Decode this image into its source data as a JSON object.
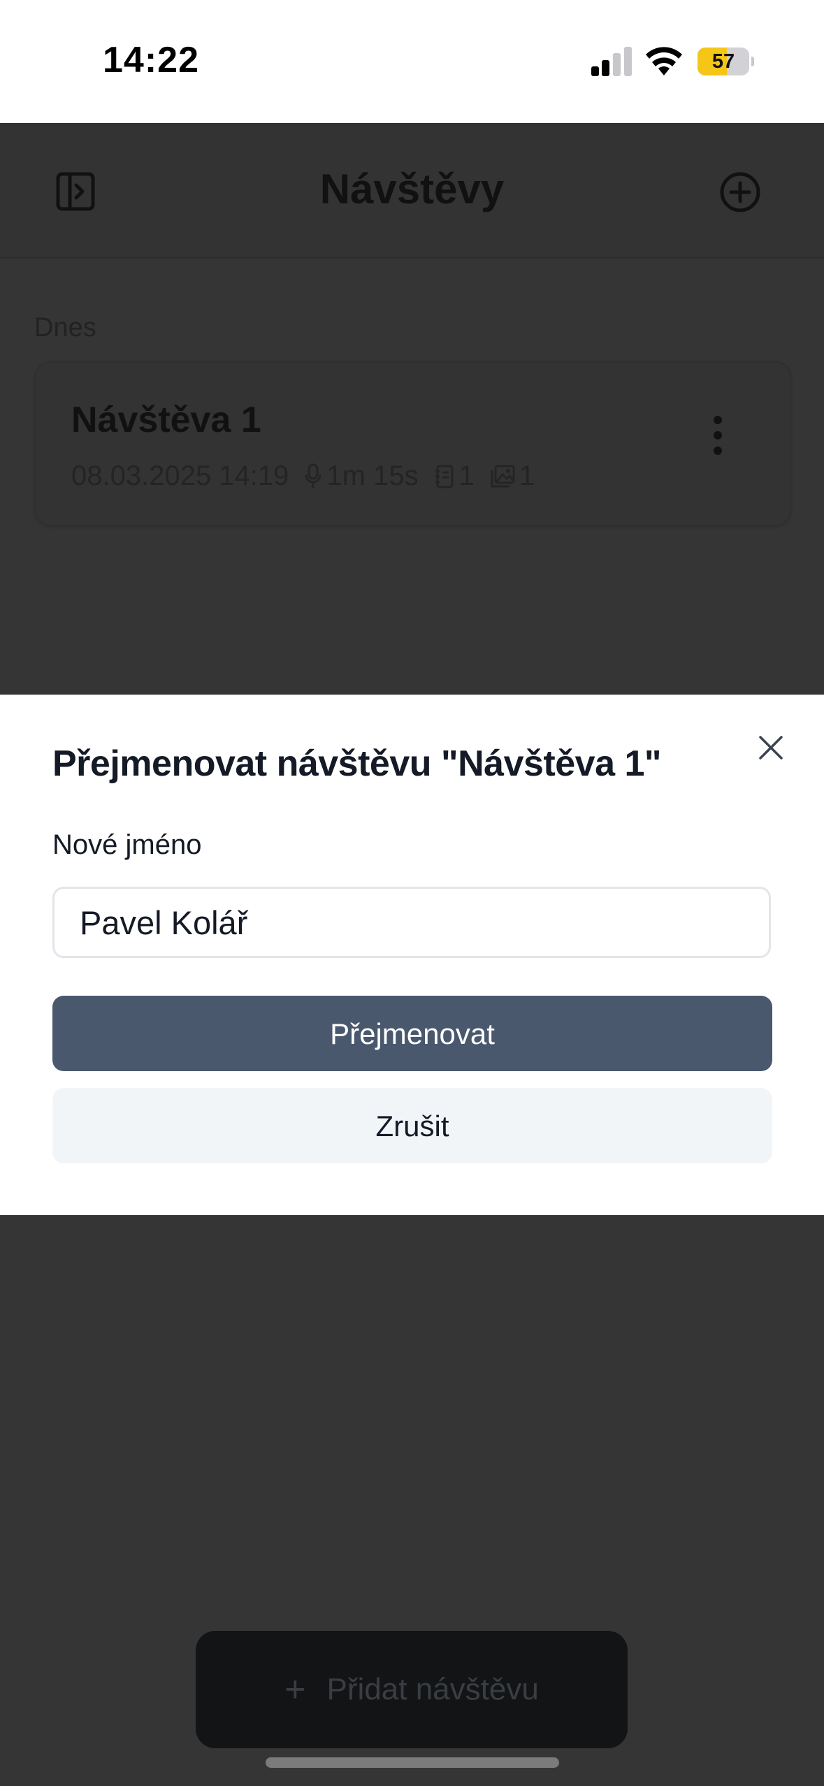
{
  "status_bar": {
    "time": "14:22",
    "battery_percent": "57",
    "battery_level": 0.57
  },
  "header": {
    "title": "Návštěvy",
    "sidebar_icon": "sidebar-toggle-icon",
    "add_icon": "plus-circle-icon"
  },
  "section": {
    "label": "Dnes"
  },
  "visit": {
    "title": "Návštěva 1",
    "datetime": "08.03.2025 14:19",
    "duration": "1m 15s",
    "notes_count": "1",
    "images_count": "1"
  },
  "modal": {
    "title": "Přejmenovat návštěvu \"Návštěva 1\"",
    "field_label": "Nové jméno",
    "input_value": "Pavel Kolář",
    "confirm_label": "Přejmenovat",
    "cancel_label": "Zrušit"
  },
  "footer": {
    "add_visit_label": "Přidat návštěvu"
  },
  "colors": {
    "primary": "#4a586e",
    "overlay": "#353535",
    "battery": "#f5c518"
  }
}
